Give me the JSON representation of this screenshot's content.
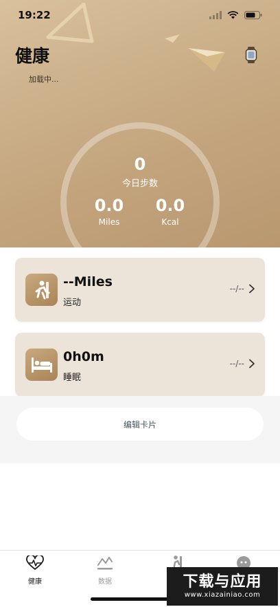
{
  "status_bar": {
    "time": "19:22"
  },
  "header": {
    "title": "健康",
    "subtitle": "加载中...",
    "watch_icon": "watch-icon"
  },
  "summary": {
    "steps_value": "0",
    "steps_label": "今日步数",
    "distance_value": "0.0",
    "distance_unit": "Miles",
    "calories_value": "0.0",
    "calories_unit": "Kcal"
  },
  "cards": [
    {
      "icon": "exercise-icon",
      "value": "--Miles",
      "label": "运动",
      "extra": "--/--"
    },
    {
      "icon": "sleep-icon",
      "value": "0h0m",
      "label": "睡眠",
      "extra": "--/--"
    }
  ],
  "edit_button": {
    "label": "编辑卡片"
  },
  "tabs": [
    {
      "label": "健康",
      "icon": "heart-pulse-icon",
      "active": true
    },
    {
      "label": "数据",
      "icon": "chart-icon",
      "active": false
    },
    {
      "label": "",
      "icon": "exercise-icon",
      "active": false
    },
    {
      "label": "",
      "icon": "profile-icon",
      "active": false
    }
  ],
  "watermark": {
    "main": "下载与应用",
    "sub": "www.xiazainiao.com"
  },
  "colors": {
    "hero_start": "#d9c19c",
    "hero_end": "#b99870",
    "card_bg": "#ece4d9",
    "icon_bg": "#b8936a"
  }
}
